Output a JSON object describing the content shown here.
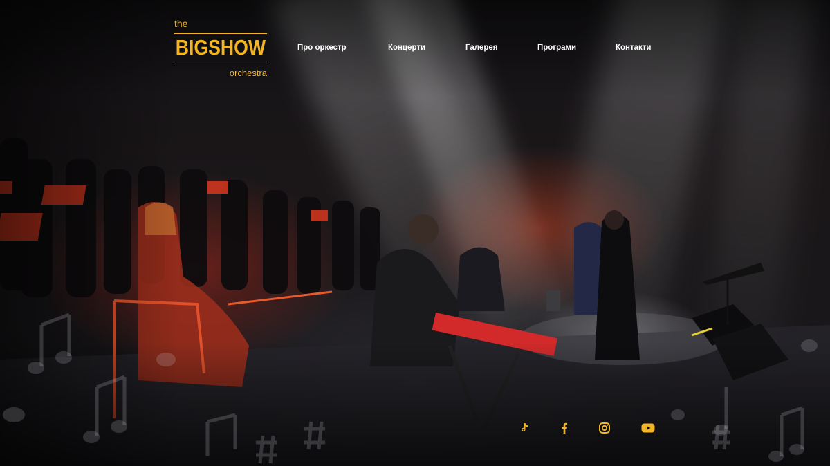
{
  "brand": {
    "logo_the": "the",
    "logo_main": "BIGSHOW",
    "logo_sub": "orchestra",
    "accent_color": "#f2b523"
  },
  "nav": {
    "items": [
      {
        "label": "Про оркестр"
      },
      {
        "label": "Концерти"
      },
      {
        "label": "Галерея"
      },
      {
        "label": "Програми"
      },
      {
        "label": "Контакти"
      }
    ]
  },
  "social": {
    "items": [
      {
        "icon": "tiktok-icon"
      },
      {
        "icon": "facebook-icon"
      },
      {
        "icon": "instagram-icon"
      },
      {
        "icon": "youtube-icon"
      }
    ],
    "color": "#f2b523"
  },
  "hero": {
    "image": "orchestra-concert-stage-photo"
  }
}
